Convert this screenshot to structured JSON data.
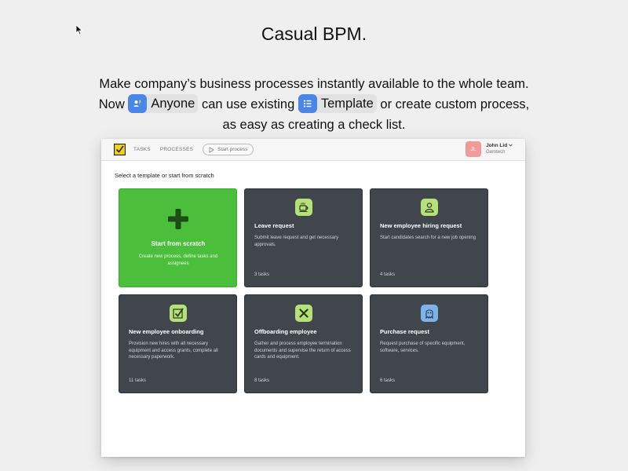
{
  "headline": "Casual BPM.",
  "intro": {
    "part1": "Make company’s business processes instantly available to the whole team. Now",
    "chip_anyone": "Anyone",
    "part2": "can use existing",
    "chip_template": "Template",
    "part3": "or create custom process, as easy as creating a check list."
  },
  "app": {
    "nav": {
      "tasks": "TASKS",
      "processes": "PROCESSES",
      "start_process": "Start process"
    },
    "user": {
      "initials": "JL",
      "name": "John Lid",
      "org": "Gemtech"
    },
    "section_title": "Select a template or start from scratch",
    "cards": [
      {
        "title": "Start from scratch",
        "desc": "Create new process, define tasks and assignees",
        "count": ""
      },
      {
        "title": "Leave request",
        "desc": "Submit leave request and get necessary approvals.",
        "count": "3 tasks",
        "icon": "coffee-icon"
      },
      {
        "title": "New employee hiring request",
        "desc": "Start candidates search for a new job opening",
        "count": "4 tasks",
        "icon": "person-icon"
      },
      {
        "title": "New employee onboarding",
        "desc": "Provision new hires with all necessary equipment and access grants, complete all necessary paperwork.",
        "count": "11 tasks",
        "icon": "checkmark-icon"
      },
      {
        "title": "Offboarding employee",
        "desc": "Gather and process employee termination documents and supervise the return of access cards and equipment.",
        "count": "8 tasks",
        "icon": "cross-icon"
      },
      {
        "title": "Purchase request",
        "desc": "Request purchase of specific equipment, software, services.",
        "count": "6 tasks",
        "icon": "ghost-icon"
      }
    ]
  },
  "colors": {
    "page_bg": "#efefef",
    "accent_blue": "#4a86e8",
    "scratch_green": "#4bbf3b",
    "card_dark": "#40464b",
    "icon_lime": "#b6e07a",
    "icon_blue": "#7eb3e8",
    "avatar_pink": "#f19a9a",
    "logo_yellow": "#f2d21b"
  }
}
